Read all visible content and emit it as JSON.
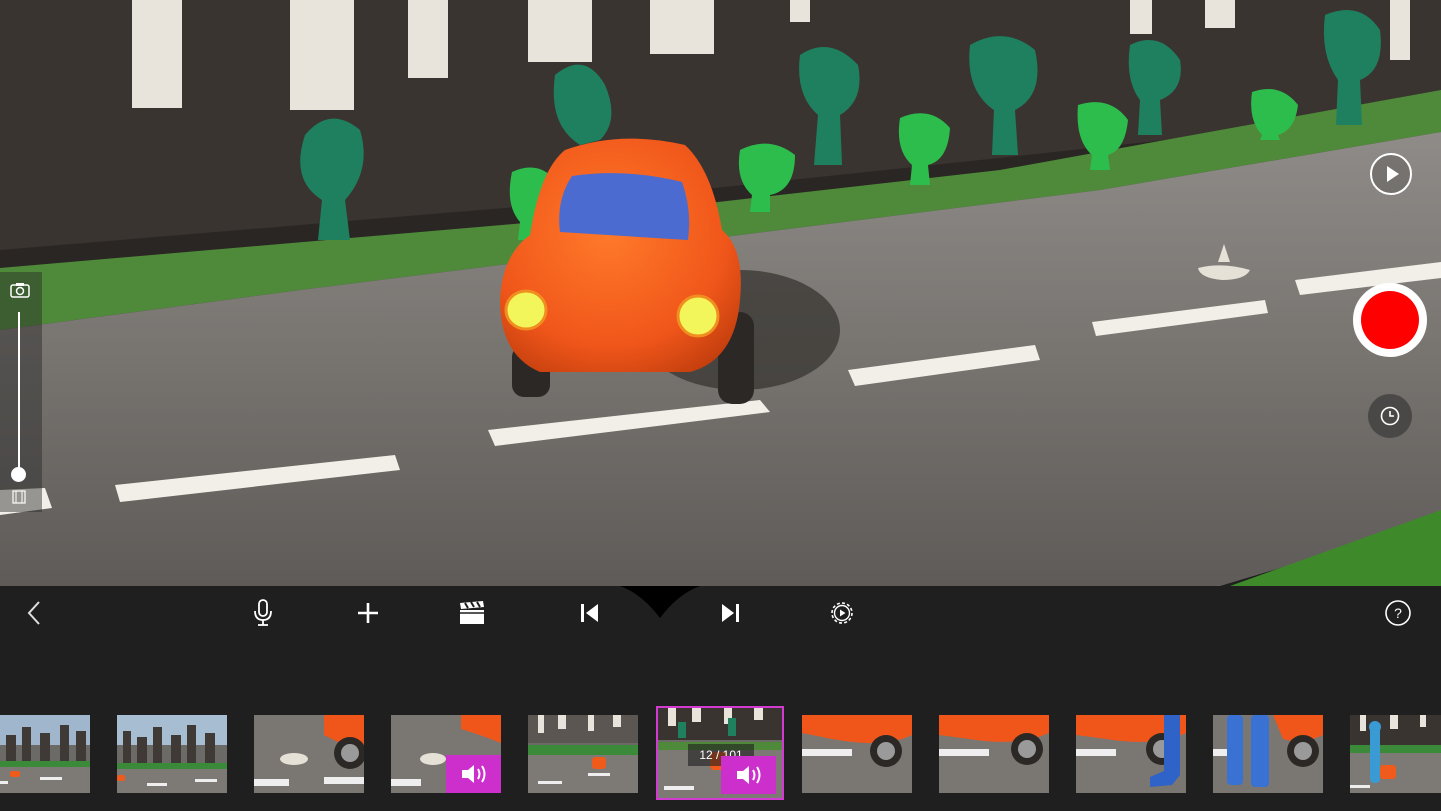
{
  "viewfinder": {
    "scene": "clay-car-on-road"
  },
  "controls": {
    "left": {
      "camera_icon": "camera-icon",
      "film_icon": "film-icon",
      "zoom_level": 0.0
    },
    "right": {
      "play_icon": "play-icon",
      "record_color": "#ff0000",
      "timer_icon": "clock-icon"
    }
  },
  "toolbar": {
    "items": [
      "back-icon",
      "microphone-icon",
      "plus-icon",
      "clapperboard-icon",
      "skip-start-icon",
      "skip-end-icon",
      "settings-gear-icon",
      "help-icon"
    ],
    "help_label": "?"
  },
  "filmstrip": {
    "frame_counter": "12 / 101",
    "accent_color": "#cc2fcc",
    "selected_index": 5
  }
}
